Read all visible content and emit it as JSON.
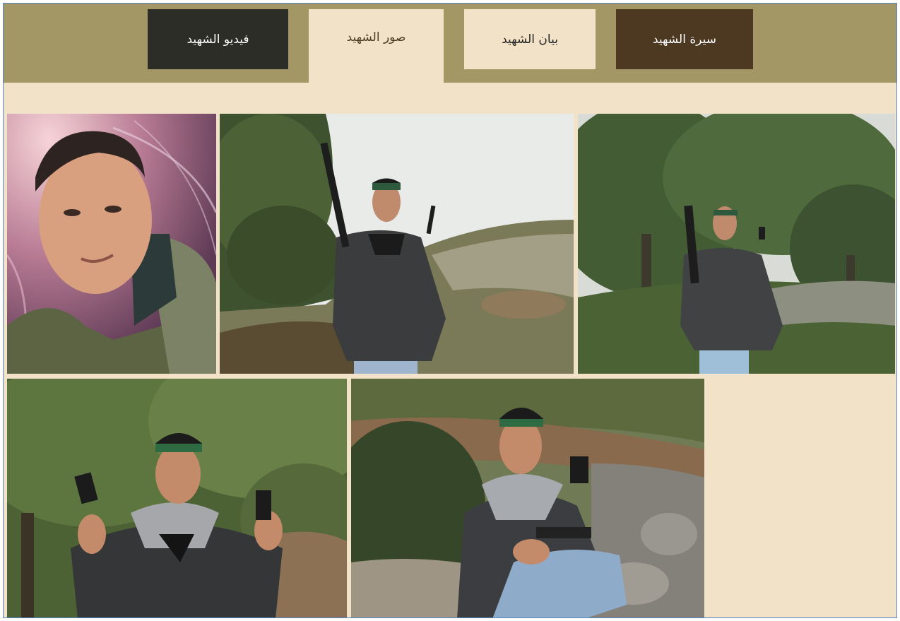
{
  "tabs": {
    "video": "فيديو الشهيد",
    "photos": "صور الشهيد",
    "statement": "بيان الشهيد",
    "biography": "سيرة الشهيد"
  },
  "active_tab": "photos",
  "colors": {
    "tabbar_bg": "#a39766",
    "content_bg": "#f2e3c8",
    "tab_video_bg": "#2d2d28",
    "tab_biography_bg": "#4d3822",
    "frame_border": "#5b86c4"
  },
  "gallery": {
    "photos": [
      {
        "subject": "portrait-photo"
      },
      {
        "subject": "standing-rifle-photo"
      },
      {
        "subject": "olive-tree-rifle-photo"
      },
      {
        "subject": "headband-pistol-photo"
      },
      {
        "subject": "kneeling-pistol-photo"
      }
    ]
  }
}
